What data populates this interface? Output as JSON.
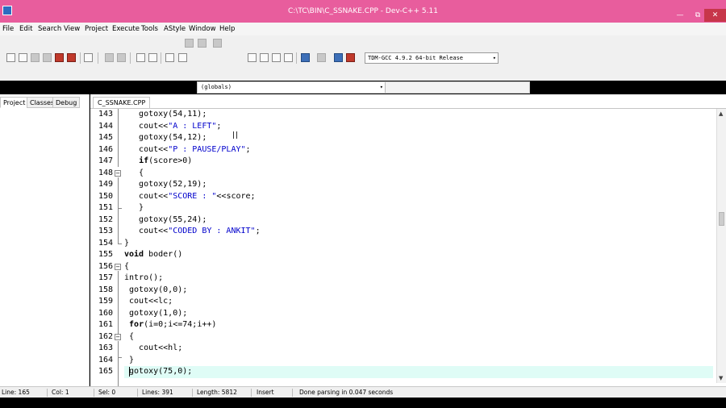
{
  "window": {
    "title": "C:\\TC\\BIN\\C_SSNAKE.CPP - Dev-C++ 5.11",
    "minimize_glyph": "—",
    "maximize_glyph": "⧉",
    "close_glyph": "✕"
  },
  "menu": {
    "items": [
      "File",
      "Edit",
      "Search",
      "View",
      "Project",
      "Execute",
      "Tools",
      "AStyle",
      "Window",
      "Help"
    ]
  },
  "toolbar": {
    "compiler": "TDM-GCC 4.9.2 64-bit Release",
    "arrow_glyph": "▾"
  },
  "scope_bar": {
    "scope": "(globals)"
  },
  "left_panel": {
    "tabs": [
      "Project",
      "Classes",
      "Debug"
    ]
  },
  "editor": {
    "file_tab": "C_SSNAKE.CPP",
    "line_numbers": [
      "143",
      "144",
      "145",
      "146",
      "147",
      "148",
      "149",
      "150",
      "151",
      "152",
      "153",
      "154",
      "155",
      "156",
      "157",
      "158",
      "159",
      "160",
      "161",
      "162",
      "163",
      "164",
      "165"
    ],
    "fold_marker": "−"
  },
  "status": {
    "line": "Line:    165",
    "col": "Col:     1",
    "sel": "Sel:     0",
    "lines": "Lines:   391",
    "length": "Length:  5812",
    "mode": "Insert",
    "message": "Done parsing in 0.047 seconds"
  },
  "scrollbar": {
    "up": "▲",
    "down": "▼"
  },
  "colors": {
    "titlebar": "#e85d9d",
    "string": "#0000cc",
    "current_line": "#dffcf6"
  }
}
